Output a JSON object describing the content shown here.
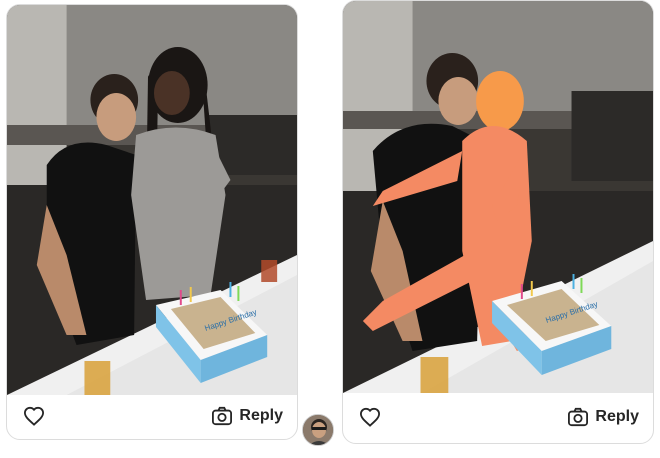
{
  "story_left": {
    "reply_label": "Reply",
    "cake_text": "Happy Birthday",
    "heart_icon": "heart-outline-icon",
    "camera_icon": "camera-icon"
  },
  "story_right": {
    "reply_label": "Reply",
    "cake_text": "Happy Birthday",
    "heart_icon": "heart-outline-icon",
    "camera_icon": "camera-icon"
  },
  "avatar": {
    "icon": "user-avatar"
  },
  "colors": {
    "text": "#262626",
    "card_border": "#dcdcdc",
    "frosting": "#7fc3e8",
    "doll": "#f48a63"
  }
}
